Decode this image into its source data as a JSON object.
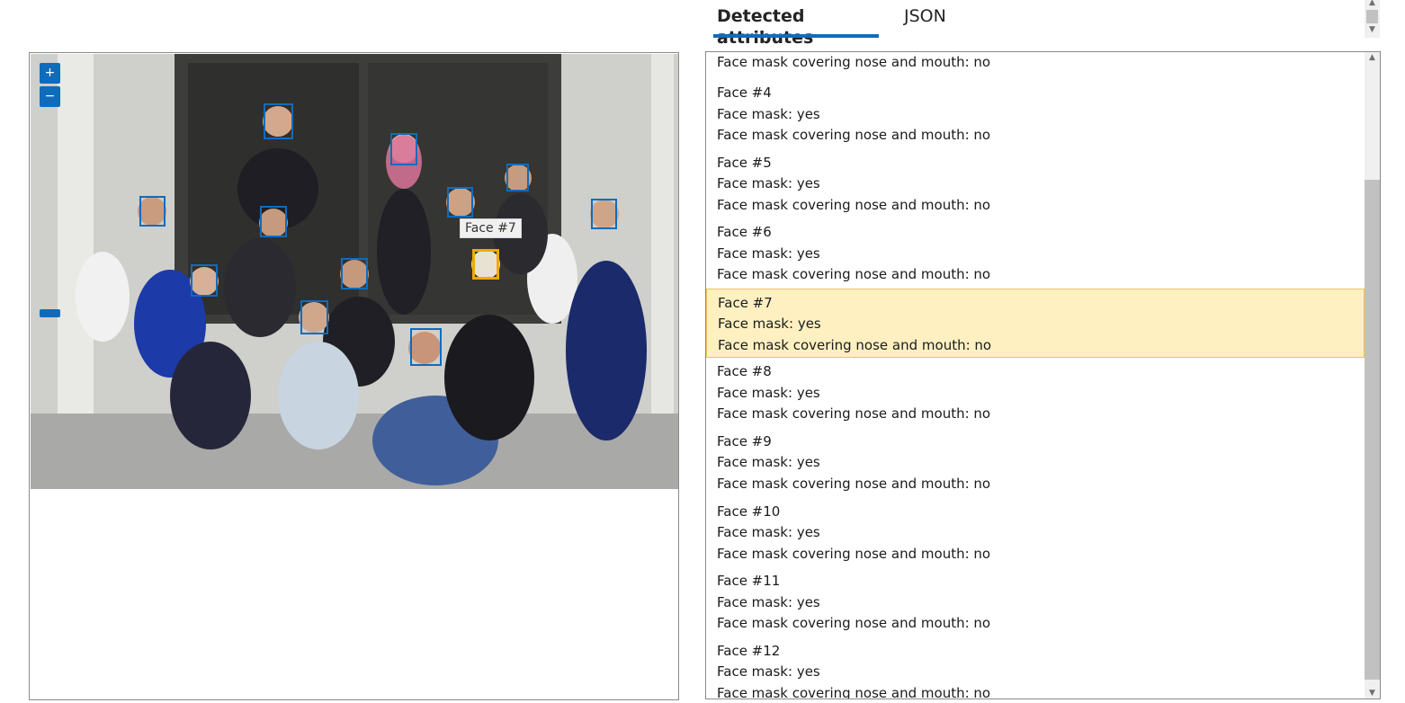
{
  "tabs": [
    {
      "label": "Detected attributes",
      "active": true
    },
    {
      "label": "JSON",
      "active": false
    }
  ],
  "image": {
    "zoom_in_label": "+",
    "zoom_out_label": "−",
    "tooltip": "Face #7"
  },
  "attributes": {
    "partial_top_line": "Face mask covering nose and mouth: no",
    "faces": [
      {
        "title": "Face #4",
        "mask": "Face mask: yes",
        "covering": "Face mask covering nose and mouth: no",
        "selected": false
      },
      {
        "title": "Face #5",
        "mask": "Face mask: yes",
        "covering": "Face mask covering nose and mouth: no",
        "selected": false
      },
      {
        "title": "Face #6",
        "mask": "Face mask: yes",
        "covering": "Face mask covering nose and mouth: no",
        "selected": false
      },
      {
        "title": "Face #7",
        "mask": "Face mask: yes",
        "covering": "Face mask covering nose and mouth: no",
        "selected": true
      },
      {
        "title": "Face #8",
        "mask": "Face mask: yes",
        "covering": "Face mask covering nose and mouth: no",
        "selected": false
      },
      {
        "title": "Face #9",
        "mask": "Face mask: yes",
        "covering": "Face mask covering nose and mouth: no",
        "selected": false
      },
      {
        "title": "Face #10",
        "mask": "Face mask: yes",
        "covering": "Face mask covering nose and mouth: no",
        "selected": false
      },
      {
        "title": "Face #11",
        "mask": "Face mask: yes",
        "covering": "Face mask covering nose and mouth: no",
        "selected": false
      },
      {
        "title": "Face #12",
        "mask": "Face mask: yes",
        "covering": "Face mask covering nose and mouth: no",
        "selected": false
      }
    ]
  },
  "colors": {
    "accent": "#0f6cbd",
    "selected_box": "#f2a900",
    "selected_row_bg": "#fff0c2"
  }
}
